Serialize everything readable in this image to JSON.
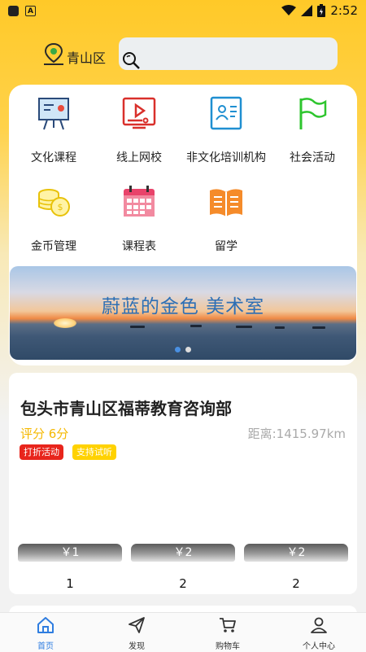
{
  "status_bar": {
    "time": "2:52"
  },
  "header": {
    "location": "青山区",
    "search_placeholder": ""
  },
  "categories": [
    {
      "label": "文化课程",
      "icon": "easel-chart-icon"
    },
    {
      "label": "线上网校",
      "icon": "video-course-icon"
    },
    {
      "label": "非文化培训机构",
      "icon": "id-card-icon"
    },
    {
      "label": "社会活动",
      "icon": "flag-icon"
    },
    {
      "label": "金币管理",
      "icon": "coins-icon"
    },
    {
      "label": "课程表",
      "icon": "calendar-icon"
    },
    {
      "label": "留学",
      "icon": "open-book-icon"
    }
  ],
  "banner": {
    "title": "蔚蓝的金色  美术室",
    "slides": 2,
    "active_slide": 0
  },
  "shop": {
    "name": "包头市青山区福蒂教育咨询部",
    "rating": "评分 6分",
    "distance": "距离:1415.97km",
    "tags": [
      "打折活动",
      "支持试听"
    ],
    "prices": [
      "￥1",
      "￥2",
      "￥2"
    ],
    "counts": [
      "1",
      "2",
      "2"
    ]
  },
  "tabs": [
    {
      "label": "首页",
      "icon": "home-icon",
      "active": true
    },
    {
      "label": "发现",
      "icon": "paper-plane-icon",
      "active": false
    },
    {
      "label": "购物车",
      "icon": "cart-icon",
      "active": false
    },
    {
      "label": "个人中心",
      "icon": "user-icon",
      "active": false
    }
  ],
  "colors": {
    "brand_yellow": "#ffc928",
    "active_tab": "#2f7de0",
    "tag_red": "#e8251c",
    "tag_yellow": "#ffd200",
    "rating": "#f5b800"
  }
}
